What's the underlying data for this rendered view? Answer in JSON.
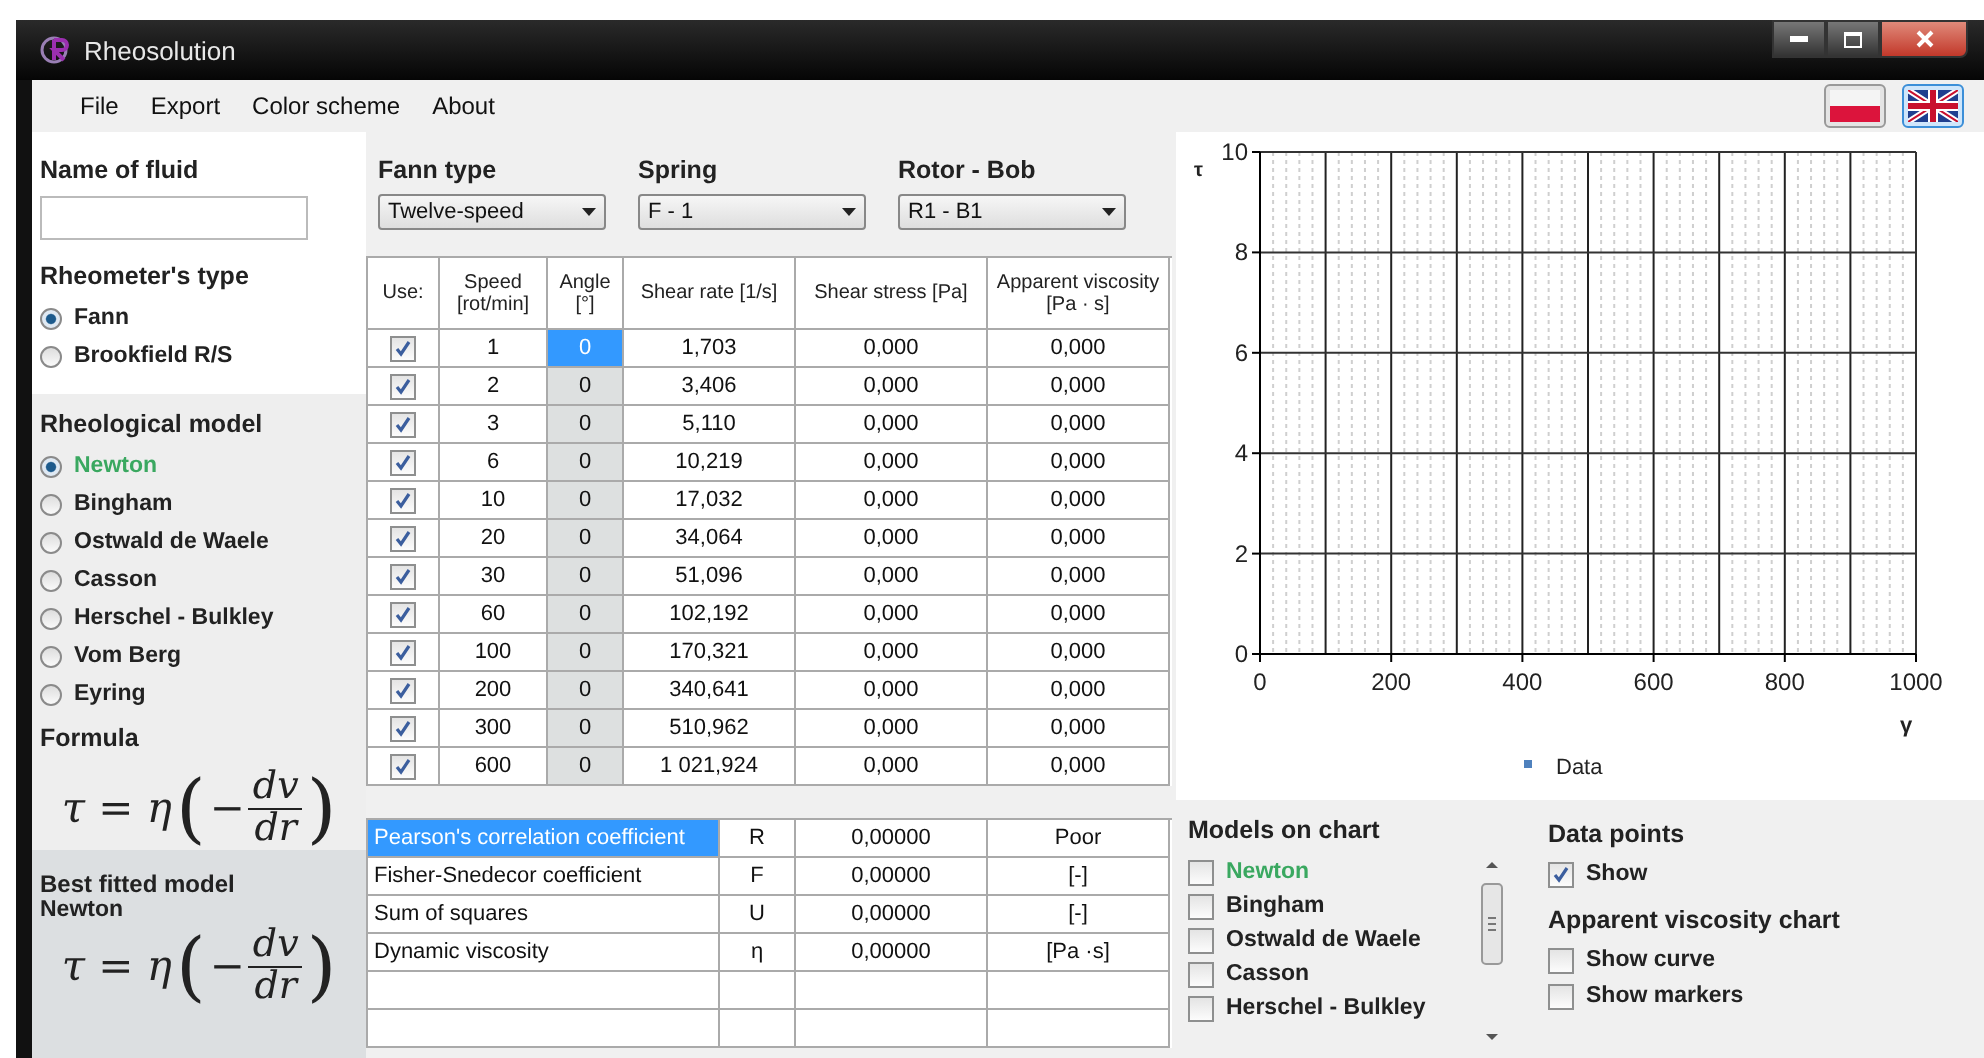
{
  "window": {
    "title": "Rheosolution"
  },
  "menu": [
    "File",
    "Export",
    "Color scheme",
    "About"
  ],
  "languages": [
    {
      "kind": "pl",
      "selected": false
    },
    {
      "kind": "uk",
      "selected": true
    }
  ],
  "fluid": {
    "label": "Name of fluid"
  },
  "rheometer": {
    "label": "Rheometer's type",
    "options": [
      {
        "label": "Fann",
        "selected": true
      },
      {
        "label": "Brookfield R/S",
        "selected": false
      }
    ]
  },
  "model": {
    "label": "Rheological model",
    "options": [
      {
        "label": "Newton",
        "selected": true,
        "color": "#3aa860"
      },
      {
        "label": "Bingham",
        "selected": false,
        "color": "#222222"
      },
      {
        "label": "Ostwald de Waele",
        "selected": false,
        "color": "#222222"
      },
      {
        "label": "Casson",
        "selected": false,
        "color": "#222222"
      },
      {
        "label": "Herschel - Bulkley",
        "selected": false,
        "color": "#222222"
      },
      {
        "label": "Vom Berg",
        "selected": false,
        "color": "#222222"
      },
      {
        "label": "Eyring",
        "selected": false,
        "color": "#222222"
      }
    ]
  },
  "formula": {
    "label": "Formula",
    "lhs": "τ = η",
    "open": "(",
    "minus": "−",
    "num": "dv",
    "den": "dr",
    "close": ")"
  },
  "best_fit": {
    "label": "Best fitted model",
    "model": "Newton",
    "lhs": "τ = η",
    "open": "(",
    "minus": "−",
    "num": "dv",
    "den": "dr",
    "close": ")"
  },
  "selectors": [
    {
      "label": "Fann type",
      "value": "Twelve-speed"
    },
    {
      "label": "Spring",
      "value": "F - 1"
    },
    {
      "label": "Rotor - Bob",
      "value": "R1 - B1"
    }
  ],
  "table": {
    "columns": [
      "Use:",
      "Speed [rot/min]",
      "Angle [°]",
      "Shear rate [1/s]",
      "Shear stress [Pa]",
      "Apparent viscosity [Pa · s]"
    ],
    "rows": [
      {
        "use": true,
        "speed": "1",
        "angle": "0",
        "angle_selected": true,
        "rate": "1,703",
        "stress": "0,000",
        "visc": "0,000"
      },
      {
        "use": true,
        "speed": "2",
        "angle": "0",
        "angle_selected": false,
        "rate": "3,406",
        "stress": "0,000",
        "visc": "0,000"
      },
      {
        "use": true,
        "speed": "3",
        "angle": "0",
        "angle_selected": false,
        "rate": "5,110",
        "stress": "0,000",
        "visc": "0,000"
      },
      {
        "use": true,
        "speed": "6",
        "angle": "0",
        "angle_selected": false,
        "rate": "10,219",
        "stress": "0,000",
        "visc": "0,000"
      },
      {
        "use": true,
        "speed": "10",
        "angle": "0",
        "angle_selected": false,
        "rate": "17,032",
        "stress": "0,000",
        "visc": "0,000"
      },
      {
        "use": true,
        "speed": "20",
        "angle": "0",
        "angle_selected": false,
        "rate": "34,064",
        "stress": "0,000",
        "visc": "0,000"
      },
      {
        "use": true,
        "speed": "30",
        "angle": "0",
        "angle_selected": false,
        "rate": "51,096",
        "stress": "0,000",
        "visc": "0,000"
      },
      {
        "use": true,
        "speed": "60",
        "angle": "0",
        "angle_selected": false,
        "rate": "102,192",
        "stress": "0,000",
        "visc": "0,000"
      },
      {
        "use": true,
        "speed": "100",
        "angle": "0",
        "angle_selected": false,
        "rate": "170,321",
        "stress": "0,000",
        "visc": "0,000"
      },
      {
        "use": true,
        "speed": "200",
        "angle": "0",
        "angle_selected": false,
        "rate": "340,641",
        "stress": "0,000",
        "visc": "0,000"
      },
      {
        "use": true,
        "speed": "300",
        "angle": "0",
        "angle_selected": false,
        "rate": "510,962",
        "stress": "0,000",
        "visc": "0,000"
      },
      {
        "use": true,
        "speed": "600",
        "angle": "0",
        "angle_selected": false,
        "rate": "1 021,924",
        "stress": "0,000",
        "visc": "0,000"
      }
    ]
  },
  "stats": [
    {
      "name": "Pearson's correlation coefficient",
      "symbol": "R",
      "value": "0,00000",
      "unit": "Poor",
      "selected": true
    },
    {
      "name": "Fisher-Snedecor coefficient",
      "symbol": "F",
      "value": "0,00000",
      "unit": "[-]",
      "selected": false
    },
    {
      "name": "Sum of squares",
      "symbol": "U",
      "value": "0,00000",
      "unit": "[-]",
      "selected": false
    },
    {
      "name": "Dynamic viscosity",
      "symbol": "η",
      "value": "0,00000",
      "unit": "[Pa ·s]",
      "selected": false
    }
  ],
  "chart": {
    "x_label": "γ",
    "y_label": "τ",
    "x_ticks": [
      "0",
      "200",
      "400",
      "600",
      "800",
      "1000"
    ],
    "y_ticks": [
      "10",
      "8",
      "6",
      "4",
      "2",
      "0"
    ],
    "grid": true,
    "legend": [
      {
        "kind": "marker",
        "name": "Data",
        "color": "#4f81bd"
      }
    ]
  },
  "models_on_chart": {
    "label": "Models on chart",
    "items": [
      {
        "label": "Newton",
        "checked": false,
        "color": "#3aa860"
      },
      {
        "label": "Bingham",
        "checked": false,
        "color": "#222222"
      },
      {
        "label": "Ostwald de Waele",
        "checked": false,
        "color": "#222222"
      },
      {
        "label": "Casson",
        "checked": false,
        "color": "#222222"
      },
      {
        "label": "Herschel - Bulkley",
        "checked": false,
        "color": "#222222"
      }
    ]
  },
  "data_points": {
    "label": "Data points",
    "options": [
      {
        "label": "Show",
        "checked": true
      }
    ]
  },
  "viscosity_chart": {
    "label": "Apparent viscosity chart",
    "options": [
      {
        "label": "Show curve",
        "checked": false
      },
      {
        "label": "Show markers",
        "checked": false
      }
    ]
  }
}
